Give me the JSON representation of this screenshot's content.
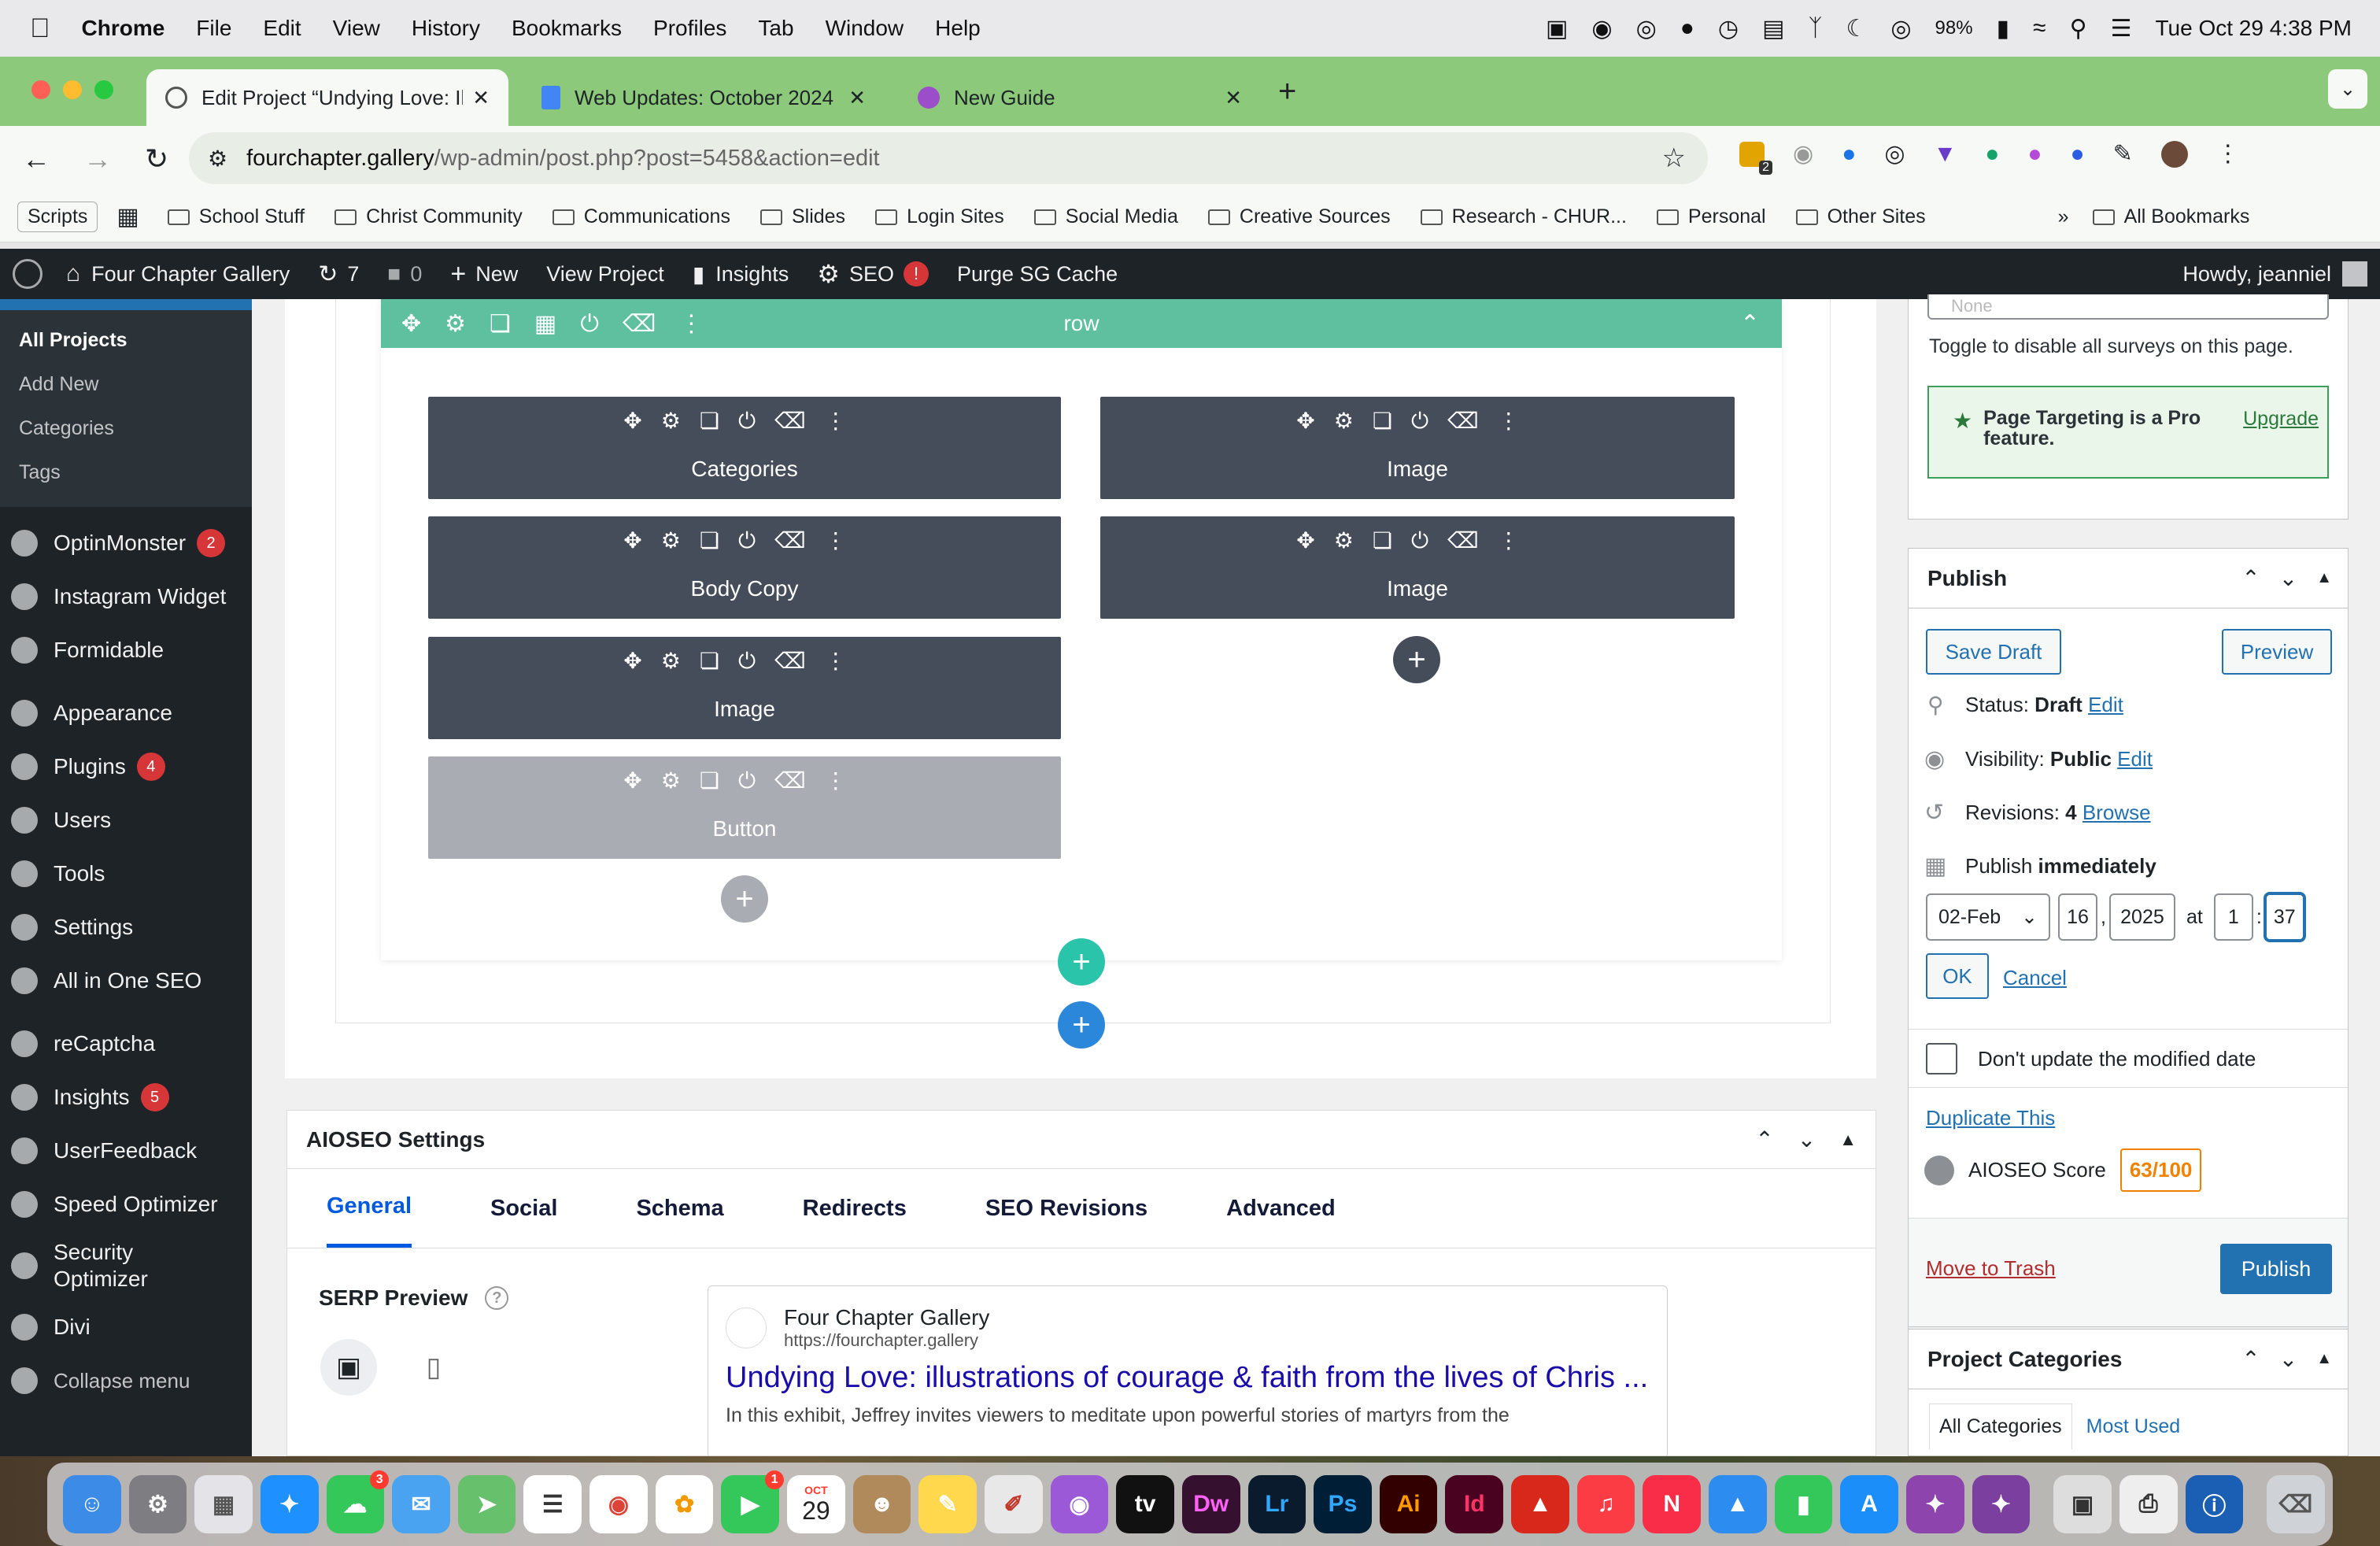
{
  "menubar": {
    "app": "Chrome",
    "menus": [
      "File",
      "Edit",
      "View",
      "History",
      "Bookmarks",
      "Profiles",
      "Tab",
      "Window",
      "Help"
    ],
    "battery": "98%",
    "datetime": "Tue Oct 29  4:38 PM"
  },
  "tabs": [
    {
      "title": "Edit Project “Undying Love: Il"
    },
    {
      "title": "Web Updates: October 2024"
    },
    {
      "title": "New Guide"
    }
  ],
  "omnibox": {
    "host": "fourchapter.gallery",
    "path": "/wp-admin/post.php?post=5458&action=edit"
  },
  "extensions": {
    "badge": "2"
  },
  "bookmarks": {
    "scripts": "Scripts",
    "items": [
      "School Stuff",
      "Christ Community",
      "Communications",
      "Slides",
      "Login Sites",
      "Social Media",
      "Creative Sources",
      "Research - CHUR...",
      "Personal",
      "Other Sites"
    ],
    "more": "»",
    "all": "All Bookmarks"
  },
  "adminbar": {
    "site": "Four Chapter Gallery",
    "updates": "7",
    "comments": "0",
    "new": "New",
    "view": "View Project",
    "insights": "Insights",
    "seo": "SEO",
    "seo_alert": "!",
    "purge": "Purge SG Cache",
    "howdy": "Howdy, jeanniel"
  },
  "sidebar": {
    "sub": [
      "All Projects",
      "Add New",
      "Categories",
      "Tags"
    ],
    "items": [
      {
        "label": "OptinMonster",
        "badge": "2"
      },
      {
        "label": "Instagram Widget",
        "badge": ""
      },
      {
        "label": "Formidable",
        "badge": ""
      },
      {
        "label": "Appearance",
        "badge": ""
      },
      {
        "label": "Plugins",
        "badge": "4"
      },
      {
        "label": "Users",
        "badge": ""
      },
      {
        "label": "Tools",
        "badge": ""
      },
      {
        "label": "Settings",
        "badge": ""
      },
      {
        "label": "All in One SEO",
        "badge": ""
      },
      {
        "label": "reCaptcha",
        "badge": ""
      },
      {
        "label": "Insights",
        "badge": "5"
      },
      {
        "label": "UserFeedback",
        "badge": ""
      },
      {
        "label": "Speed Optimizer",
        "badge": ""
      },
      {
        "label": "Security Optimizer",
        "badge": ""
      },
      {
        "label": "Divi",
        "badge": ""
      },
      {
        "label": "Collapse menu",
        "badge": ""
      }
    ]
  },
  "builder": {
    "row_label": "row",
    "modules_left": [
      "Categories",
      "Body Copy",
      "Image",
      "Button"
    ],
    "modules_right": [
      "Image",
      "Image"
    ],
    "plus": "+"
  },
  "aioseo": {
    "title": "AIOSEO Settings",
    "tabs": [
      "General",
      "Social",
      "Schema",
      "Redirects",
      "SEO Revisions",
      "Advanced"
    ],
    "serp_label": "SERP Preview",
    "serp_site": "Four Chapter Gallery",
    "serp_url": "https://fourchapter.gallery",
    "serp_title": "Undying Love: illustrations of courage & faith from the lives of Chris ...",
    "serp_desc": "In this exhibit, Jeffrey invites viewers to meditate upon powerful stories of martyrs from the"
  },
  "survey": {
    "select_value": "None",
    "toggle_text": "Toggle to disable all surveys on this page.",
    "pro_text": "Page Targeting is a Pro feature.",
    "upgrade": "Upgrade"
  },
  "publish": {
    "title": "Publish",
    "save_draft": "Save Draft",
    "preview": "Preview",
    "status_label": "Status:",
    "status_value": "Draft",
    "edit": "Edit",
    "visibility_label": "Visibility:",
    "visibility_value": "Public",
    "revisions_label": "Revisions:",
    "revisions_value": "4",
    "browse": "Browse",
    "publish_label": "Publish",
    "publish_value": "immediately",
    "month": "02-Feb",
    "day": "16",
    "year": "2025",
    "at": "at",
    "hour": "1",
    "minute": "37",
    "ok": "OK",
    "cancel": "Cancel",
    "dont_update": "Don't update the modified date",
    "duplicate": "Duplicate This",
    "score_label": "AIOSEO Score",
    "score": "63/100",
    "trash": "Move to Trash",
    "publish_btn": "Publish"
  },
  "categories": {
    "title": "Project Categories",
    "tab_all": "All Categories",
    "tab_used": "Most Used"
  },
  "dock": {
    "messages_badge": "3",
    "facetime_badge": "1",
    "calendar_month": "OCT",
    "calendar_day": "29"
  },
  "colors": {
    "accent": "#2271b1",
    "divi_row": "#5fc0a0",
    "module": "#454c5a",
    "tabbar": "#8cc97a"
  }
}
